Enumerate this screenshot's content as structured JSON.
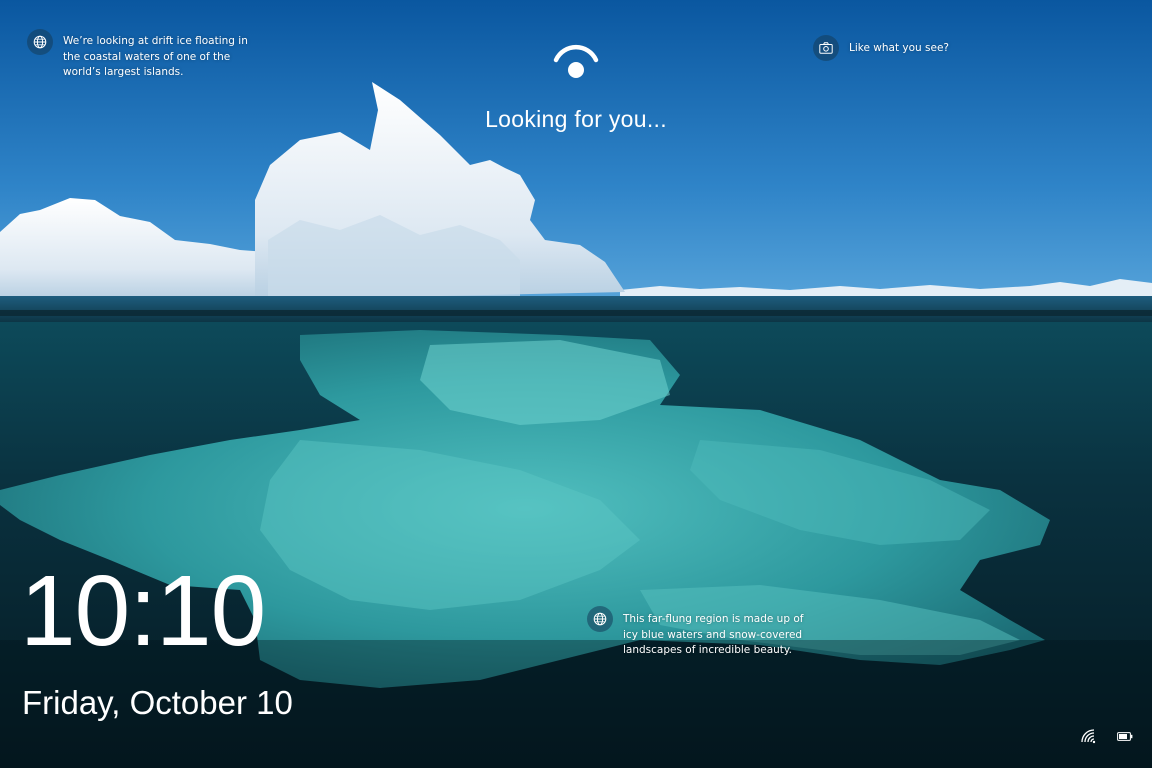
{
  "lockscreen": {
    "status_text": "Looking for you...",
    "time": "10:10",
    "date": "Friday, October 10"
  },
  "spotlight": {
    "hotspot_top_left": {
      "icon": "globe-icon",
      "text": "We’re looking at drift ice floating in the coastal waters of one of the world’s largest islands."
    },
    "hotspot_top_right": {
      "icon": "camera-icon",
      "text": "Like what you see?"
    },
    "hotspot_bottom": {
      "icon": "globe-icon",
      "text": "This far-flung region is made up of icy blue waters and snow-covered landscapes of incredible beauty."
    }
  },
  "system_tray": {
    "network_icon": "wifi-icon",
    "battery_icon": "battery-icon"
  },
  "colors": {
    "sky_top": "#0b5ea6",
    "sky_bottom": "#3d8fcf",
    "water_dark": "#062330",
    "ice_underwater": "#3fb3b6",
    "ice_above": "#eef4fa"
  }
}
